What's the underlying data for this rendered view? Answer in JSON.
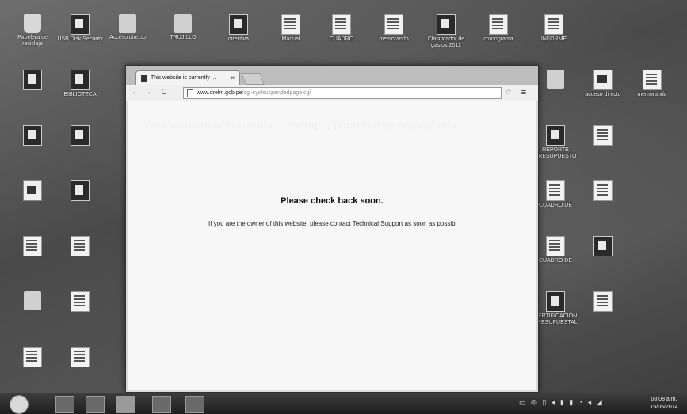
{
  "desktop": {
    "icons": [
      {
        "label": "Papelera de reciclaje",
        "glyph": "recycle"
      },
      {
        "label": "USB Disk Security",
        "glyph": "dark"
      },
      {
        "label": "Acceso directo",
        "glyph": "folder"
      },
      {
        "label": "TRUJILLO",
        "glyph": "folder"
      },
      {
        "label": "directiva",
        "glyph": "dark"
      },
      {
        "label": "Manual",
        "glyph": "doc"
      },
      {
        "label": "CUADRO",
        "glyph": "doc"
      },
      {
        "label": "memorando",
        "glyph": "doc"
      },
      {
        "label": "Clasificador de gastos 2012",
        "glyph": "dark"
      },
      {
        "label": "cronograma",
        "glyph": "doc"
      },
      {
        "label": "INFORME",
        "glyph": "doc"
      },
      {
        "label": "",
        "glyph": "dark"
      },
      {
        "label": "BIBLIOTECA",
        "glyph": "dark"
      },
      {
        "label": "",
        "glyph": "dark"
      },
      {
        "label": "",
        "glyph": "dark"
      },
      {
        "label": "",
        "glyph": "pdf"
      },
      {
        "label": "",
        "glyph": "dark"
      },
      {
        "label": "",
        "glyph": "doc"
      },
      {
        "label": "",
        "glyph": "doc"
      },
      {
        "label": "",
        "glyph": "folder"
      },
      {
        "label": "",
        "glyph": "doc"
      },
      {
        "label": "",
        "glyph": "doc"
      },
      {
        "label": "",
        "glyph": "doc"
      },
      {
        "label": "",
        "glyph": "folder"
      },
      {
        "label": "acceso directo",
        "glyph": "pdf"
      },
      {
        "label": "memorando",
        "glyph": "doc"
      },
      {
        "label": "REPORTE PRESUPUESTO",
        "glyph": "dark"
      },
      {
        "label": "",
        "glyph": "doc"
      },
      {
        "label": "CUADRO DE",
        "glyph": "doc"
      },
      {
        "label": "",
        "glyph": "doc"
      },
      {
        "label": "CUADRO DE",
        "glyph": "doc"
      },
      {
        "label": "",
        "glyph": "dark"
      },
      {
        "label": "CERTIFICACION PRESUPUESTAL",
        "glyph": "dark"
      },
      {
        "label": "",
        "glyph": "doc"
      }
    ]
  },
  "browser": {
    "tab_title": "This website is currently ...",
    "tab_close": "×",
    "url_host": "www.drelm.gob.pe",
    "url_path": "/cgi-sys/suspendedpage.cgi",
    "nav_back": "←",
    "nav_forward": "→",
    "nav_reload": "C",
    "star": "☆",
    "menu": "≡",
    "page": {
      "header": "This website is currently ... being ... temporarily unavailable.",
      "heading": "Please check back soon.",
      "owner_message": "If you are the owner of this website, please contact Technical Support as soon as possib"
    }
  },
  "taskbar": {
    "tray_icons": "▭ ◎ ▯ ◂ ▮ ▮ ◔ ◂ ◢",
    "time": "08:08 a.m.",
    "date": "15/05/2014"
  },
  "colors": {
    "desktop_bg": "#5a5a5a",
    "page_bg": "#f7f7f7"
  }
}
